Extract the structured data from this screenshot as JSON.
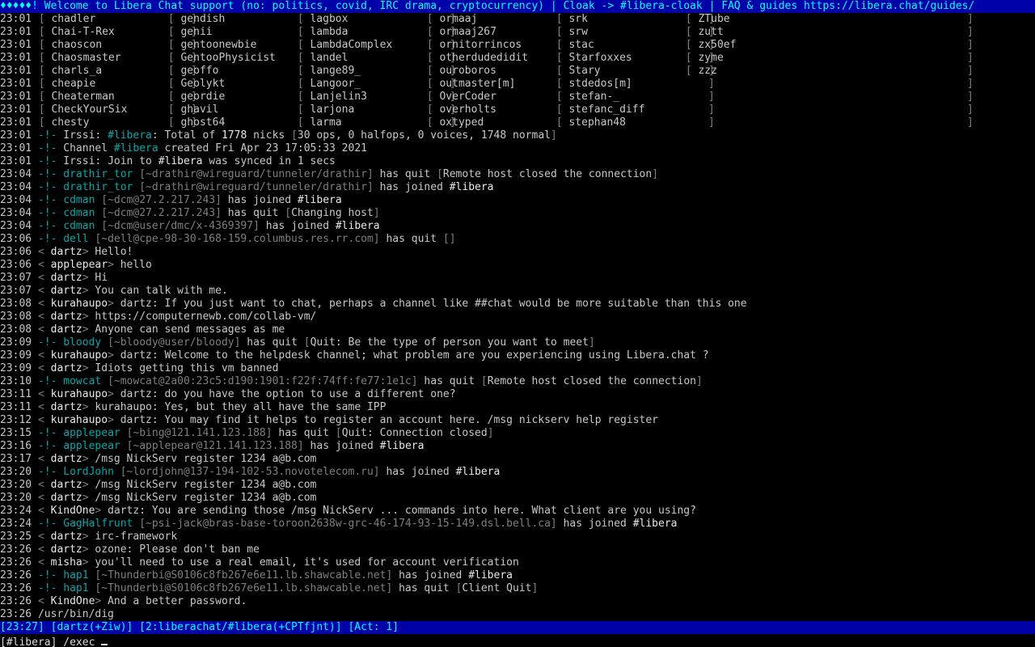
{
  "topic": "♦♦♦♦♦! Welcome to Libera Chat support (no: politics, covid, IRC drama, cryptocurrency) | Cloak -> #libera-cloak | FAQ & guides https://libera.chat/guides/",
  "names_time": "23:01",
  "names_rows": [
    [
      "chadler",
      "gendish",
      "lagbox",
      "ormaaj",
      "srk",
      "ZTube"
    ],
    [
      "Chai-T-Rex",
      "genii",
      "lambda",
      "ormaaj267",
      "srw",
      "zutt"
    ],
    [
      "chaoscon",
      "gentoonewbie",
      "LambdaComplex",
      "ornitorrincos",
      "stac",
      "zx50ef"
    ],
    [
      "Chaosmaster",
      "GentooPhysicist",
      "landel",
      "otherdudedidit",
      "Starfoxxes",
      "zyme"
    ],
    [
      "charls_a",
      "geoffo",
      "lange89_",
      "ouroboros",
      "Stary",
      "zzz"
    ],
    [
      "cheapie",
      "Geolykt",
      "Langoor_",
      "outmaster[m]",
      "stdedos[m]",
      ""
    ],
    [
      "Cheaterman",
      "geordie",
      "Lanjelin3",
      "OverCoder",
      "stefan-_",
      ""
    ],
    [
      "CheckYourSix",
      "ghavil",
      "larjona",
      "overholts",
      "stefanc_diff",
      ""
    ],
    [
      "chesty",
      "ghost64",
      "larma",
      "oxtyped",
      "stephan48",
      ""
    ]
  ],
  "lines": [
    {
      "time": "23:01",
      "kind": "sys",
      "text": [
        {
          "c": "t",
          "s": "Irssi: "
        },
        {
          "c": "cy",
          "s": "#libera"
        },
        {
          "c": "t",
          "s": ": Total of "
        },
        {
          "c": "wh",
          "s": "1778"
        },
        {
          "c": "t",
          "s": " nicks "
        },
        {
          "c": "dim",
          "s": "["
        },
        {
          "c": "t",
          "s": "30 ops, 0 halfops, 0 voices, 1748 normal"
        },
        {
          "c": "dim",
          "s": "]"
        }
      ]
    },
    {
      "time": "23:01",
      "kind": "sys",
      "text": [
        {
          "c": "t",
          "s": "Channel "
        },
        {
          "c": "cy",
          "s": "#libera"
        },
        {
          "c": "t",
          "s": " created Fri Apr 23 17:05:33 2021"
        }
      ]
    },
    {
      "time": "23:01",
      "kind": "sys",
      "text": [
        {
          "c": "t",
          "s": "Irssi: Join to "
        },
        {
          "c": "wh",
          "s": "#libera"
        },
        {
          "c": "t",
          "s": " was synced in 1 secs"
        }
      ]
    },
    {
      "time": "23:04",
      "kind": "sys",
      "text": [
        {
          "c": "cy",
          "s": "drathir_tor"
        },
        {
          "c": "t",
          "s": " "
        },
        {
          "c": "dim",
          "s": "[~drathir@wireguard/tunneler/drathir]"
        },
        {
          "c": "t",
          "s": " has quit "
        },
        {
          "c": "dim",
          "s": "["
        },
        {
          "c": "t",
          "s": "Remote host closed the connection"
        },
        {
          "c": "dim",
          "s": "]"
        }
      ]
    },
    {
      "time": "23:04",
      "kind": "sys",
      "text": [
        {
          "c": "cy",
          "s": "drathir_tor"
        },
        {
          "c": "t",
          "s": " "
        },
        {
          "c": "dim",
          "s": "[~drathir@wireguard/tunneler/drathir]"
        },
        {
          "c": "t",
          "s": " has joined "
        },
        {
          "c": "wh",
          "s": "#libera"
        }
      ]
    },
    {
      "time": "23:04",
      "kind": "sys",
      "text": [
        {
          "c": "cy",
          "s": "cdman"
        },
        {
          "c": "t",
          "s": " "
        },
        {
          "c": "dim",
          "s": "[~dcm@27.2.217.243]"
        },
        {
          "c": "t",
          "s": " has joined "
        },
        {
          "c": "wh",
          "s": "#libera"
        }
      ]
    },
    {
      "time": "23:04",
      "kind": "sys",
      "text": [
        {
          "c": "cy",
          "s": "cdman"
        },
        {
          "c": "t",
          "s": " "
        },
        {
          "c": "dim",
          "s": "[~dcm@27.2.217.243]"
        },
        {
          "c": "t",
          "s": " has quit "
        },
        {
          "c": "dim",
          "s": "["
        },
        {
          "c": "t",
          "s": "Changing host"
        },
        {
          "c": "dim",
          "s": "]"
        }
      ]
    },
    {
      "time": "23:04",
      "kind": "sys",
      "text": [
        {
          "c": "cy",
          "s": "cdman"
        },
        {
          "c": "t",
          "s": " "
        },
        {
          "c": "dim",
          "s": "[~dcm@user/dmc/x-4369397]"
        },
        {
          "c": "t",
          "s": " has joined "
        },
        {
          "c": "wh",
          "s": "#libera"
        }
      ]
    },
    {
      "time": "23:06",
      "kind": "sys",
      "text": [
        {
          "c": "cy",
          "s": "dell"
        },
        {
          "c": "t",
          "s": " "
        },
        {
          "c": "dim",
          "s": "[~dell@cpe-98-30-168-159.columbus.res.rr.com]"
        },
        {
          "c": "t",
          "s": " has quit "
        },
        {
          "c": "dim",
          "s": "[]"
        }
      ]
    },
    {
      "time": "23:06",
      "kind": "msg",
      "nick": "dartz",
      "msg": "Hello!"
    },
    {
      "time": "23:06",
      "kind": "msg",
      "nick": "applepear",
      "msg": "hello"
    },
    {
      "time": "23:07",
      "kind": "msg",
      "nick": "dartz",
      "msg": "Hi"
    },
    {
      "time": "23:07",
      "kind": "msg",
      "nick": "dartz",
      "msg": "You can talk with me."
    },
    {
      "time": "23:08",
      "kind": "msg",
      "nick": "kurahaupo",
      "msg": "dartz: If you just want to chat, perhaps a channel like ##chat would be more suitable than this one"
    },
    {
      "time": "23:08",
      "kind": "msg",
      "nick": "dartz",
      "msg": "https://computernewb.com/collab-vm/"
    },
    {
      "time": "23:08",
      "kind": "msg",
      "nick": "dartz",
      "msg": "Anyone can send messages as me"
    },
    {
      "time": "23:09",
      "kind": "sys",
      "text": [
        {
          "c": "cy",
          "s": "bloody"
        },
        {
          "c": "t",
          "s": " "
        },
        {
          "c": "dim",
          "s": "[~bloody@user/bloody]"
        },
        {
          "c": "t",
          "s": " has quit "
        },
        {
          "c": "dim",
          "s": "["
        },
        {
          "c": "t",
          "s": "Quit: Be the type of person you want to meet"
        },
        {
          "c": "dim",
          "s": "]"
        }
      ]
    },
    {
      "time": "23:09",
      "kind": "msg",
      "nick": "kurahaupo",
      "msg": "dartz: Welcome to the helpdesk channel; what problem are you experiencing using Libera.chat ?"
    },
    {
      "time": "23:09",
      "kind": "msg",
      "nick": "dartz",
      "msg": "Idiots getting this vm banned"
    },
    {
      "time": "23:10",
      "kind": "sys",
      "text": [
        {
          "c": "cy",
          "s": "mowcat"
        },
        {
          "c": "t",
          "s": " "
        },
        {
          "c": "dim",
          "s": "[~mowcat@2a00:23c5:d190:1901:f22f:74ff:fe77:1e1c]"
        },
        {
          "c": "t",
          "s": " has quit "
        },
        {
          "c": "dim",
          "s": "["
        },
        {
          "c": "t",
          "s": "Remote host closed the connection"
        },
        {
          "c": "dim",
          "s": "]"
        }
      ]
    },
    {
      "time": "23:11",
      "kind": "msg",
      "nick": "kurahaupo",
      "msg": "dartz: do you have the option to use a different one?"
    },
    {
      "time": "23:11",
      "kind": "msg",
      "nick": "dartz",
      "msg": "kurahaupo: Yes, but they all have the same IPP"
    },
    {
      "time": "23:12",
      "kind": "msg",
      "nick": "kurahaupo",
      "msg": "dartz: You may find it helps to register an account here. /msg nickserv help register"
    },
    {
      "time": "23:15",
      "kind": "sys",
      "text": [
        {
          "c": "cy",
          "s": "applepear"
        },
        {
          "c": "t",
          "s": " "
        },
        {
          "c": "dim",
          "s": "[~bing@121.141.123.188]"
        },
        {
          "c": "t",
          "s": " has quit "
        },
        {
          "c": "dim",
          "s": "["
        },
        {
          "c": "t",
          "s": "Quit: Connection closed"
        },
        {
          "c": "dim",
          "s": "]"
        }
      ]
    },
    {
      "time": "23:16",
      "kind": "sys",
      "text": [
        {
          "c": "cy",
          "s": "applepear"
        },
        {
          "c": "t",
          "s": " "
        },
        {
          "c": "dim",
          "s": "[~applepear@121.141.123.188]"
        },
        {
          "c": "t",
          "s": " has joined "
        },
        {
          "c": "wh",
          "s": "#libera"
        }
      ]
    },
    {
      "time": "23:17",
      "kind": "msg",
      "nick": "dartz",
      "msg": "/msg NickServ register 1234 a@b.com"
    },
    {
      "time": "23:20",
      "kind": "sys",
      "text": [
        {
          "c": "cy",
          "s": "LordJohn"
        },
        {
          "c": "t",
          "s": " "
        },
        {
          "c": "dim",
          "s": "[~lordjohn@137-194-102-53.novotelecom.ru]"
        },
        {
          "c": "t",
          "s": " has joined "
        },
        {
          "c": "wh",
          "s": "#libera"
        }
      ]
    },
    {
      "time": "23:20",
      "kind": "msg",
      "nick": "dartz",
      "msg": "/msg NickServ register 1234 a@b.com"
    },
    {
      "time": "23:20",
      "kind": "msg",
      "nick": "dartz",
      "msg": "/msg NickServ register 1234 a@b.com"
    },
    {
      "time": "23:24",
      "kind": "msg",
      "nick": "KindOne",
      "msg": "dartz: You are sending those /msg NickServ ... commands into here. What client are you using?"
    },
    {
      "time": "23:24",
      "kind": "sys",
      "text": [
        {
          "c": "cy",
          "s": "GagHalfrunt"
        },
        {
          "c": "t",
          "s": " "
        },
        {
          "c": "dim",
          "s": "[~psi-jack@bras-base-toroon2638w-grc-46-174-93-15-149.dsl.bell.ca]"
        },
        {
          "c": "t",
          "s": " has joined "
        },
        {
          "c": "wh",
          "s": "#libera"
        }
      ]
    },
    {
      "time": "23:25",
      "kind": "msg",
      "nick": "dartz",
      "msg": "irc-framework"
    },
    {
      "time": "23:26",
      "kind": "msg",
      "nick": "dartz",
      "msg": "ozone: Please don't ban me"
    },
    {
      "time": "23:26",
      "kind": "msg",
      "nick": "misha",
      "msg": "you'll need to use a real email, it's used for account verification"
    },
    {
      "time": "23:26",
      "kind": "sys",
      "text": [
        {
          "c": "cy",
          "s": "hap1"
        },
        {
          "c": "t",
          "s": " "
        },
        {
          "c": "dim",
          "s": "[~Thunderbi@S0106c8fb267e6e11.lb.shawcable.net]"
        },
        {
          "c": "t",
          "s": " has joined "
        },
        {
          "c": "wh",
          "s": "#libera"
        }
      ]
    },
    {
      "time": "23:26",
      "kind": "sys",
      "text": [
        {
          "c": "cy",
          "s": "hap1"
        },
        {
          "c": "t",
          "s": " "
        },
        {
          "c": "dim",
          "s": "[~Thunderbi@S0106c8fb267e6e11.lb.shawcable.net]"
        },
        {
          "c": "t",
          "s": " has quit "
        },
        {
          "c": "dim",
          "s": "["
        },
        {
          "c": "t",
          "s": "Client Quit"
        },
        {
          "c": "dim",
          "s": "]"
        }
      ]
    },
    {
      "time": "23:26",
      "kind": "msg",
      "nick": "KindOne",
      "msg": "And a better password."
    },
    {
      "time": "23:26",
      "kind": "plain",
      "msg": "/usr/bin/dig"
    }
  ],
  "statusbar": "[23:27] [dartz(+Ziw)] [2:liberachat/#libera(+CPTfjnt)] [Act: 1]",
  "input": {
    "prompt": "[#libera]",
    "value": "/exec "
  },
  "colors": {
    "statusbar_bg": "#0000a8",
    "accent": "#00aaaa",
    "background": "#000000"
  }
}
